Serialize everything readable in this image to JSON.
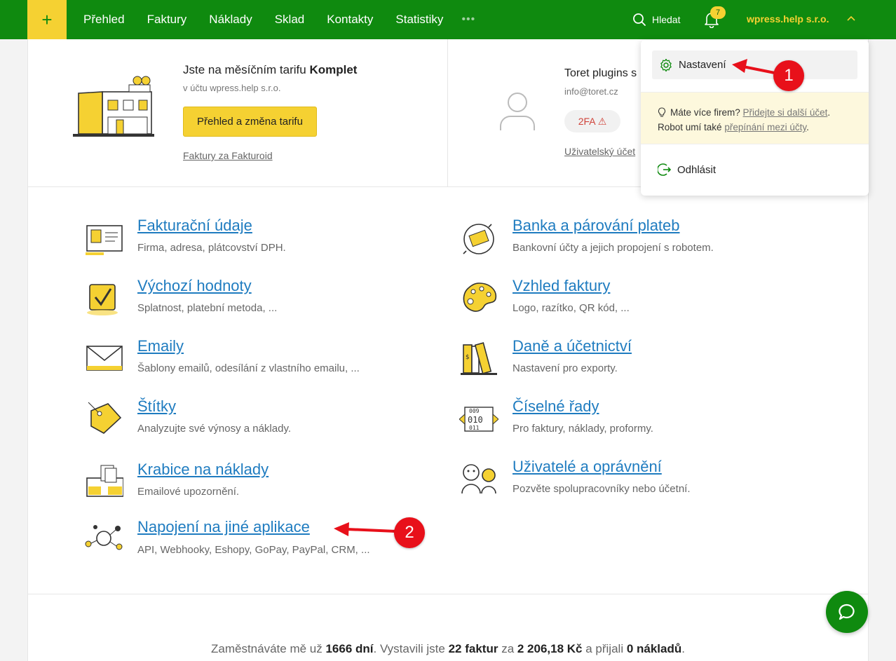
{
  "topbar": {
    "plus": "+",
    "nav": [
      "Přehled",
      "Faktury",
      "Náklady",
      "Sklad",
      "Kontakty",
      "Statistiky"
    ],
    "more": "•••",
    "search_label": "Hledat",
    "notifications_count": "7",
    "company": "wpress.help s.r.o."
  },
  "plan": {
    "title_prefix": "Jste na měsíčním tarifu ",
    "title_plan": "Komplet",
    "subtitle": "v účtu wpress.help s.r.o.",
    "button": "Přehled a změna tarifu",
    "link": "Faktury za Fakturoid"
  },
  "user": {
    "name": "Toret plugins s",
    "email": "info@toret.cz",
    "twofa": "2FA ⚠",
    "link": "Uživatelský účet"
  },
  "settings": [
    {
      "title": "Fakturační údaje",
      "desc": "Firma, adresa, plátcovství DPH."
    },
    {
      "title": "Banka a párování plateb",
      "desc": "Bankovní účty a jejich propojení s robotem."
    },
    {
      "title": "Výchozí hodnoty",
      "desc": "Splatnost, platební metoda, ..."
    },
    {
      "title": "Vzhled faktury",
      "desc": "Logo, razítko, QR kód, ..."
    },
    {
      "title": "Emaily",
      "desc": "Šablony emailů, odesílání z vlastního emailu, ..."
    },
    {
      "title": "Daně a účetnictví",
      "desc": "Nastavení pro exporty."
    },
    {
      "title": "Štítky",
      "desc": "Analyzujte své výnosy a náklady."
    },
    {
      "title": "Číselné řady",
      "desc": "Pro faktury, náklady, proformy."
    },
    {
      "title": "Krabice na náklady",
      "desc": "Emailové upozornění."
    },
    {
      "title": "Uživatelé a oprávnění",
      "desc": "Pozvěte spolupracovníky nebo účetní."
    },
    {
      "title": "Napojení na jiné aplikace",
      "desc": "API, Webhooky, Eshopy, GoPay, PayPal, CRM, ..."
    }
  ],
  "footer": {
    "p1": "Zaměstnáváte mě už ",
    "days": "1666 dní",
    "p2": ". Vystavili jste ",
    "invoices": "22 faktur",
    "p3": " za ",
    "amount": "2 206,18 Kč",
    "p4": " a přijali ",
    "expenses": "0 nákladů",
    "p5": "."
  },
  "dropdown": {
    "settings": "Nastavení",
    "info_q": "Máte více firem? ",
    "info_link1": "Přidejte si další účet",
    "info_end1": ".",
    "info_line2": "Robot umí také ",
    "info_link2": "přepínání mezi účty",
    "info_end2": ".",
    "logout": "Odhlásit"
  },
  "annotations": {
    "callout1": "1",
    "callout2": "2"
  },
  "colors": {
    "brand_green": "#0f8a0f",
    "accent_yellow": "#f5d132",
    "link_blue": "#1f7cc0",
    "callout_red": "#e8101a"
  }
}
